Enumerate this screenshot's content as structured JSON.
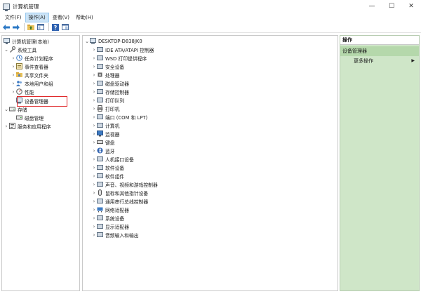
{
  "window": {
    "title": "计算机管理",
    "minimize_glyph": "—",
    "maximize_glyph": "☐",
    "close_glyph": "✕"
  },
  "menu": {
    "items": [
      "文件(F)",
      "操作(A)",
      "查看(V)",
      "帮助(H)"
    ],
    "active_index": 1
  },
  "toolbar": {
    "buttons": [
      "back-arrow-icon",
      "forward-arrow-icon",
      "up-folder-icon",
      "console-tree-icon",
      "help-icon",
      "properties-icon"
    ]
  },
  "left_tree": {
    "root": "计算机管理(本地)",
    "system_tools": "系统工具",
    "task_scheduler": "任务计划程序",
    "event_viewer": "事件查看器",
    "shared_folders": "共享文件夹",
    "local_users": "本地用户和组",
    "performance": "性能",
    "device_manager": "设备管理器",
    "storage": "存储",
    "disk_management": "磁盘管理",
    "services_apps": "服务和应用程序"
  },
  "device_tree": {
    "computer_name": "DESKTOP-D838JK0",
    "categories": [
      "IDE ATA/ATAPI 控制器",
      "WSD 打印提供程序",
      "安全设备",
      "处理器",
      "磁盘驱动器",
      "存储控制器",
      "打印队列",
      "打印机",
      "端口 (COM 和 LPT)",
      "计算机",
      "监视器",
      "键盘",
      "蓝牙",
      "人机接口设备",
      "软件设备",
      "软件组件",
      "声音、视频和游戏控制器",
      "鼠标和其他指针设备",
      "通用串行总线控制器",
      "网络适配器",
      "系统设备",
      "显示适配器",
      "音频输入和输出"
    ]
  },
  "actions_panel": {
    "title": "操作",
    "section": "设备管理器",
    "more_actions": "更多操作",
    "more_arrow": "▶"
  },
  "colors": {
    "actions_bg": "#cfe6c8",
    "actions_section": "#b5d8ab",
    "highlight_box": "#e0292b",
    "menu_active": "#cce4f7"
  }
}
